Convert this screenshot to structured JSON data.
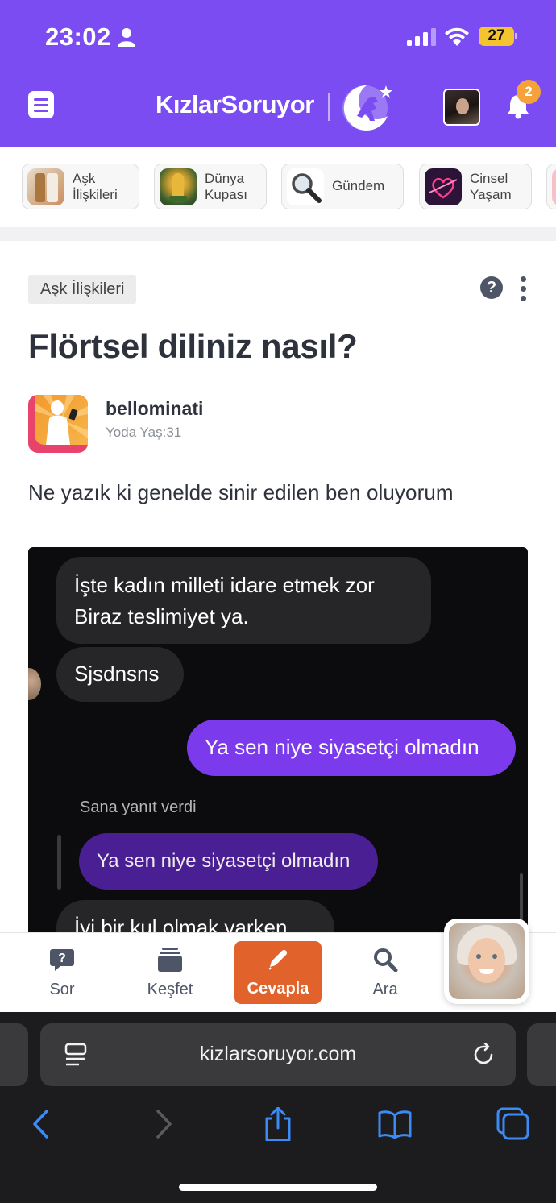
{
  "status_bar": {
    "time": "23:02",
    "battery": "27"
  },
  "header": {
    "logo_text": "KızlarSoruyor",
    "notification_count": "2"
  },
  "categories": [
    {
      "label": "Aşk\nİlişkileri",
      "icon": "ask-iliskileri-thumb"
    },
    {
      "label": "Dünya\nKupası",
      "icon": "world-cup-trophy-thumb"
    },
    {
      "label": "Gündem",
      "icon": "magnifier-thumb"
    },
    {
      "label": "Cinsel\nYaşam",
      "icon": "neon-heart-thumb"
    }
  ],
  "question": {
    "tag": "Aşk İlişkileri",
    "help_symbol": "?",
    "title": "Flörtsel diliniz nasıl?",
    "author": {
      "name": "bellominati",
      "meta": "Yoda Yaş:31"
    },
    "body": "Ne yazık ki genelde sinir edilen ben oluyorum"
  },
  "chat_image": {
    "messages": [
      {
        "text": "İşte kadın milleti idare etmek zor\nBiraz teslimiyet ya.",
        "side": "left"
      },
      {
        "text": "Sjsdnsns",
        "side": "left"
      },
      {
        "text": "Ya sen niye siyasetçi olmadın",
        "side": "right"
      },
      {
        "text": "Ya sen niye siyasetçi olmadın",
        "side": "reply"
      },
      {
        "text": "İyi bir kul olmak varken",
        "side": "left"
      }
    ],
    "reply_label": "Sana yanıt verdi",
    "colors": {
      "bubble_gray": "#262628",
      "bubble_purple": "#7c3aed",
      "reply_purple": "#4a1f94"
    }
  },
  "tabbar": {
    "tabs": [
      {
        "label": "Sor",
        "icon": "question-bubble-icon"
      },
      {
        "label": "Keşfet",
        "icon": "stack-icon"
      },
      {
        "label": "Cevapla",
        "icon": "pencil-icon",
        "active": true
      },
      {
        "label": "Ara",
        "icon": "search-icon"
      }
    ]
  },
  "browser": {
    "url": "kizlarsoruyor.com"
  },
  "colors": {
    "brand_purple": "#7b4cf1",
    "accent_orange": "#e2622b",
    "badge_orange": "#f5a23b",
    "text_dark": "#2e323c"
  }
}
